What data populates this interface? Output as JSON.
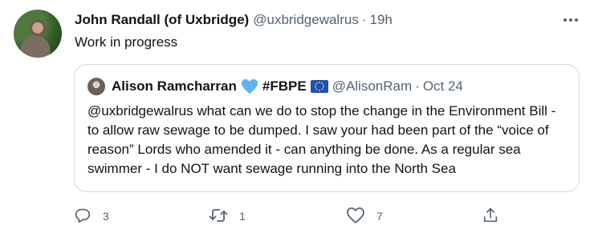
{
  "tweet": {
    "author_name": "John Randall (of Uxbridge)",
    "handle": "@uxbridgewalrus",
    "separator": "·",
    "time": "19h",
    "text": "Work in progress"
  },
  "quoted": {
    "author_name": "Alison Ramcharran",
    "hashtag": "#FBPE",
    "handle": "@AlisonRam",
    "separator": "·",
    "time": "Oct 24",
    "text": "@uxbridgewalrus what can we do to stop the change in the Environment Bill - to allow raw sewage to be dumped. I saw your had been part of the “voice of reason” Lords who amended it - can anything be done. As a regular sea swimmer - I do NOT want sewage running into the North Sea"
  },
  "actions": {
    "reply_count": "3",
    "retweet_count": "1",
    "like_count": "7",
    "share_count": ""
  },
  "colors": {
    "text": "#0f1419",
    "secondary": "#536471",
    "border": "#cfd9de",
    "heart": "#5cb5f0"
  },
  "icons": [
    "more-icon",
    "blue-heart-emoji",
    "eu-flag-emoji",
    "reply-icon",
    "retweet-icon",
    "like-icon",
    "share-icon"
  ]
}
